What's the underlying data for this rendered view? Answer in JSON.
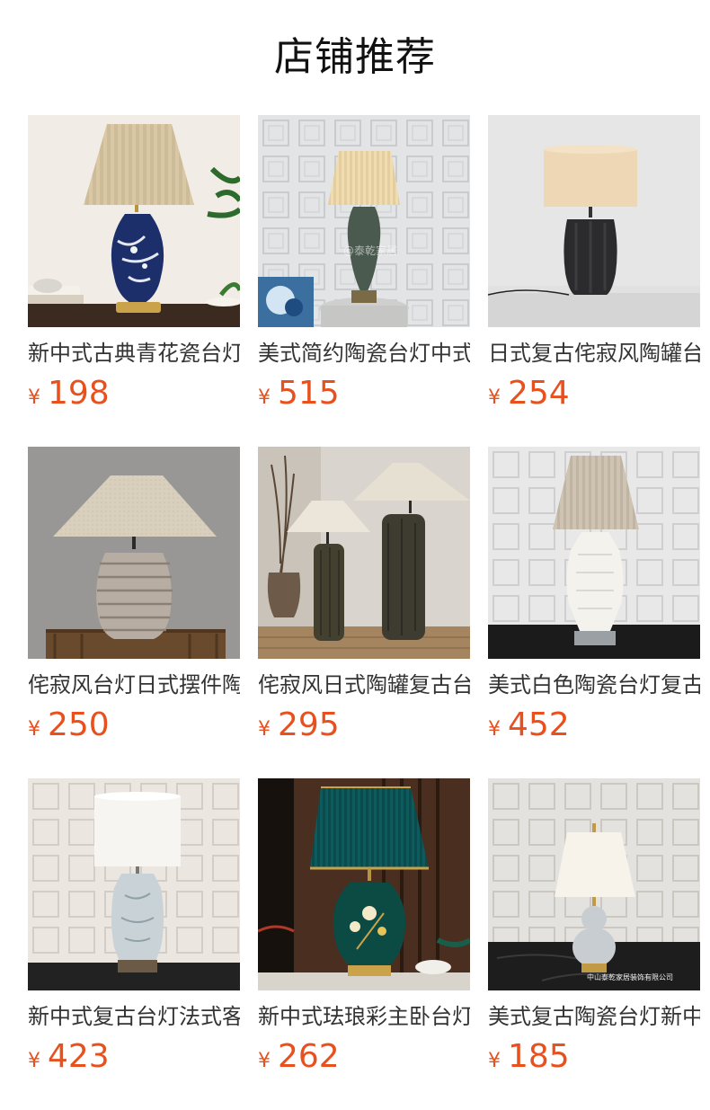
{
  "page_title": "店铺推荐",
  "currency_symbol": "¥",
  "accent_color": "#e8501e",
  "products": [
    {
      "name": "新中式古典青花瓷台灯",
      "price": "198",
      "image": "blue-white-porcelain-lamp"
    },
    {
      "name": "美式简约陶瓷台灯中式",
      "price": "515",
      "image": "dark-ceramic-lamp-pleated-shade",
      "watermark": "@泰乾家居"
    },
    {
      "name": "日式复古侘寂风陶罐台灯",
      "price": "254",
      "image": "black-wabi-sabi-pot-lamp"
    },
    {
      "name": "侘寂风台灯日式摆件陶罐",
      "price": "250",
      "image": "textured-stoneware-lamp"
    },
    {
      "name": "侘寂风日式陶罐复古台灯",
      "price": "295",
      "image": "twin-tall-ceramic-lamps"
    },
    {
      "name": "美式白色陶瓷台灯复古",
      "price": "452",
      "image": "white-ceramic-lamp"
    },
    {
      "name": "新中式复古台灯法式客厅",
      "price": "423",
      "image": "blue-floral-ginger-jar-lamp"
    },
    {
      "name": "新中式珐琅彩主卧台灯",
      "price": "262",
      "image": "green-enamel-floral-lamp"
    },
    {
      "name": "美式复古陶瓷台灯新中式",
      "price": "185",
      "image": "grey-gourd-lamp",
      "watermark": "中山泰乾家居装饰有限公司"
    }
  ]
}
